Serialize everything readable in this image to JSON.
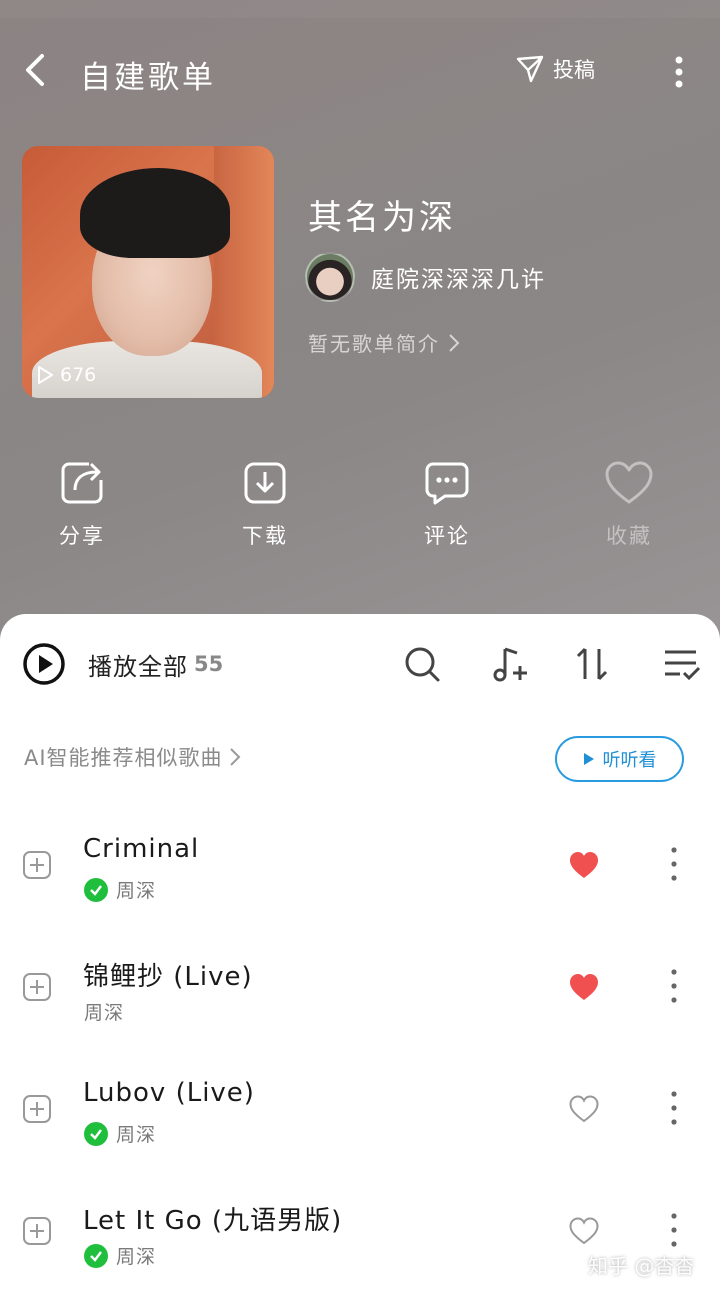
{
  "header": {
    "title": "自建歌单",
    "submit_label": "投稿"
  },
  "playlist": {
    "play_count": "676",
    "name": "其名为深",
    "creator": "庭院深深深几许",
    "description": "暂无歌单简介"
  },
  "actions": [
    {
      "label": "分享",
      "icon": "share-icon"
    },
    {
      "label": "下载",
      "icon": "download-icon"
    },
    {
      "label": "评论",
      "icon": "comment-icon"
    },
    {
      "label": "收藏",
      "icon": "heart-icon"
    }
  ],
  "list": {
    "play_all_label": "播放全部",
    "count": "55",
    "ai_recommend": "AI智能推荐相似歌曲",
    "listen_button": "听听看"
  },
  "songs": [
    {
      "title": "Criminal",
      "artist": "周深",
      "vip": true,
      "liked": true
    },
    {
      "title": "锦鲤抄 (Live)",
      "artist": "周深",
      "vip": false,
      "liked": true
    },
    {
      "title": "Lubov (Live)",
      "artist": "周深",
      "vip": true,
      "liked": false
    },
    {
      "title": "Let It Go (九语男版)",
      "artist": "周深",
      "vip": true,
      "liked": false
    }
  ],
  "colors": {
    "accent": "#2b9be0",
    "liked": "#f0504f",
    "vip": "#1fbf3d"
  },
  "watermark": "知乎 @杳杳"
}
